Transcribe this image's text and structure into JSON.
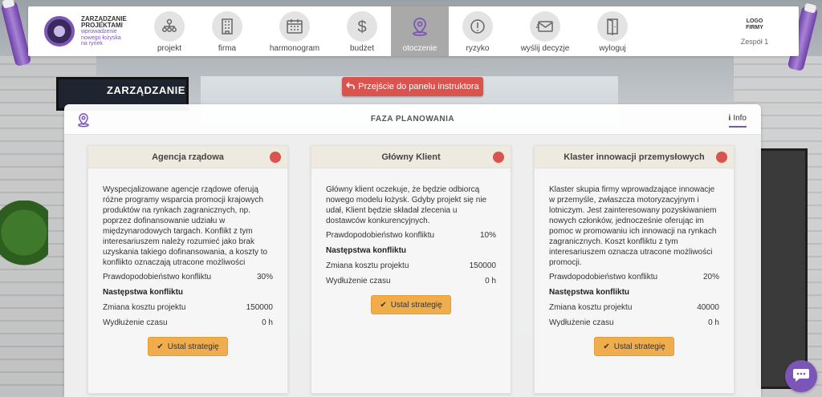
{
  "logo": {
    "title_line1": "ZARZĄDZANIE",
    "title_line2": "PROJEKTAMI",
    "sub_line1": "wprowadzenie",
    "sub_line2": "nowego łożyska",
    "sub_line3": "na rynek"
  },
  "nav": {
    "items": [
      {
        "label": "projekt",
        "icon": "org-chart-icon"
      },
      {
        "label": "firma",
        "icon": "building-icon"
      },
      {
        "label": "harmonogram",
        "icon": "calendar-icon"
      },
      {
        "label": "budżet",
        "icon": "dollar-icon"
      },
      {
        "label": "otoczenie",
        "icon": "location-pin-icon",
        "active": true
      },
      {
        "label": "ryzyko",
        "icon": "risk-icon"
      },
      {
        "label": "wyślij decyzje",
        "icon": "envelope-icon"
      },
      {
        "label": "wyloguj",
        "icon": "door-icon"
      }
    ]
  },
  "firm": {
    "logo_line1": "LOGO",
    "logo_line2": "FIRMY",
    "team": "Zespół 1"
  },
  "background": {
    "tv_text": "ZARZĄDZANIE"
  },
  "instructor_button": "Przejście do panelu instruktora",
  "panel": {
    "title": "FAZA PLANOWANIA",
    "info": "Info"
  },
  "cards": [
    {
      "title": "Agencja rządowa",
      "description": "Wyspecjalizowane agencje rządowe oferują różne programy wsparcia promocji krajowych produktów na rynkach zagranicznych, np. poprzez dofinansowanie udziału w międzynarodowych targach. Konflikt z tym interesariuszem należy rozumieć jako brak uzyskania takiego dofinansowania, a koszty to konflikto oznaczają utracone możliwości",
      "probability_label": "Prawdopodobieństwo konfliktu",
      "probability": "30%",
      "consequences_label": "Następstwa konfliktu",
      "cost_label": "Zmiana kosztu projektu",
      "cost": "150000",
      "time_label": "Wydłużenie czasu",
      "time": "0 h",
      "button": "Ustal strategię"
    },
    {
      "title": "Główny Klient",
      "description": "Główny klient oczekuje, że będzie odbiorcą nowego modelu łożysk. Gdyby projekt się nie udał, Klient będzie składał zlecenia u dostawców konkurencyjnych.",
      "probability_label": "Prawdopodobieństwo konfliktu",
      "probability": "10%",
      "consequences_label": "Następstwa konfliktu",
      "cost_label": "Zmiana kosztu projektu",
      "cost": "150000",
      "time_label": "Wydłużenie czasu",
      "time": "0 h",
      "button": "Ustal strategię"
    },
    {
      "title": "Klaster innowacji przemysłowych",
      "description": "Klaster skupia firmy wprowadzające innowacje w przemyśle, zwłaszcza motoryzacyjnym i lotniczym. Jest zainteresowany pozyskiwaniem nowych członków, jednocześnie oferując im pomoc w promowaniu ich innowacji na rynkach zagranicznych. Koszt konfliktu z tym interesariuszem oznacza utracone możliwości promocji.",
      "probability_label": "Prawdopodobieństwo konfliktu",
      "probability": "20%",
      "consequences_label": "Następstwa konfliktu",
      "cost_label": "Zmiana kosztu projektu",
      "cost": "40000",
      "time_label": "Wydłużenie czasu",
      "time": "0 h",
      "button": "Ustal strategię"
    }
  ],
  "colors": {
    "accent": "#7c55b8",
    "danger": "#d9534f",
    "warning": "#f0ad4e"
  }
}
